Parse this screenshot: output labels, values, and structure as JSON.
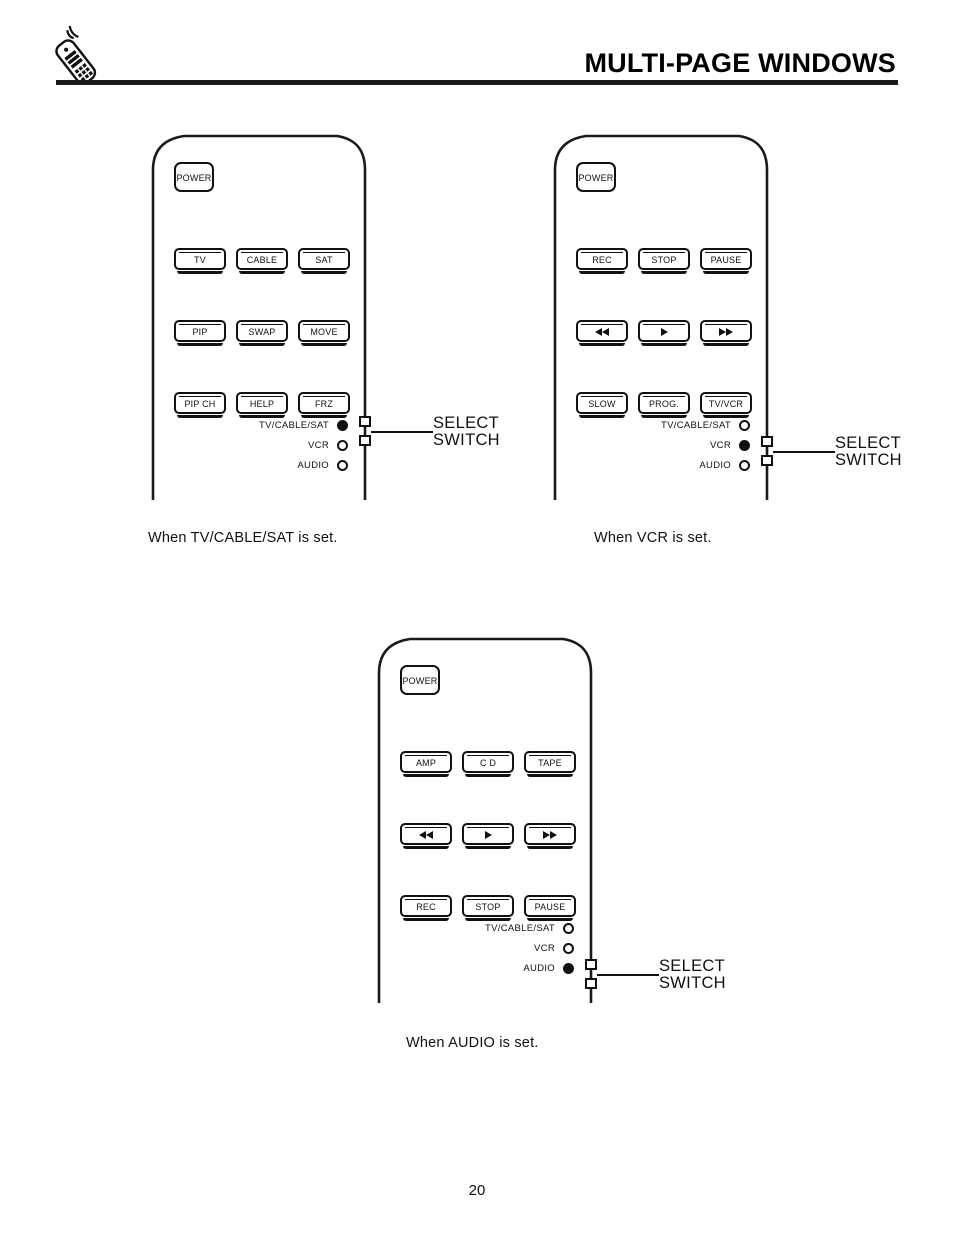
{
  "header": {
    "title": "MULTI-PAGE WINDOWS",
    "icon": "remote-control-signal-icon"
  },
  "page_number": "20",
  "switch_label": {
    "line1": "SELECT",
    "line2": "SWITCH"
  },
  "remotes": [
    {
      "id": "remote-tv-cable-sat",
      "caption": "When  TV/CABLE/SAT  is set.",
      "power": "POWER",
      "rows": [
        [
          "TV",
          "CABLE",
          "SAT"
        ],
        [
          "PIP",
          "SWAP",
          "MOVE"
        ],
        [
          "PIP CH",
          "HELP",
          "FRZ"
        ]
      ],
      "glyph_rows": [],
      "indicators": [
        {
          "label": "TV/CABLE/SAT",
          "selected": true
        },
        {
          "label": "VCR",
          "selected": false
        },
        {
          "label": "AUDIO",
          "selected": false
        }
      ],
      "switch_position": "TV/CABLE/SAT"
    },
    {
      "id": "remote-vcr",
      "caption": "When  VCR  is set.",
      "power": "POWER",
      "rows": [
        [
          "REC",
          "STOP",
          "PAUSE"
        ],
        [
          "rewind-icon",
          "play-icon",
          "fast-forward-icon"
        ],
        [
          "SLOW",
          "PROG.",
          "TV/VCR"
        ]
      ],
      "glyph_rows": [
        1
      ],
      "indicators": [
        {
          "label": "TV/CABLE/SAT",
          "selected": false
        },
        {
          "label": "VCR",
          "selected": true
        },
        {
          "label": "AUDIO",
          "selected": false
        }
      ],
      "switch_position": "VCR"
    },
    {
      "id": "remote-audio",
      "caption": "When  AUDIO  is set.",
      "power": "POWER",
      "rows": [
        [
          "AMP",
          "C D",
          "TAPE"
        ],
        [
          "rewind-icon",
          "play-icon",
          "fast-forward-icon"
        ],
        [
          "REC",
          "STOP",
          "PAUSE"
        ]
      ],
      "glyph_rows": [
        1
      ],
      "indicators": [
        {
          "label": "TV/CABLE/SAT",
          "selected": false
        },
        {
          "label": "VCR",
          "selected": false
        },
        {
          "label": "AUDIO",
          "selected": true
        }
      ],
      "switch_position": "AUDIO"
    }
  ]
}
